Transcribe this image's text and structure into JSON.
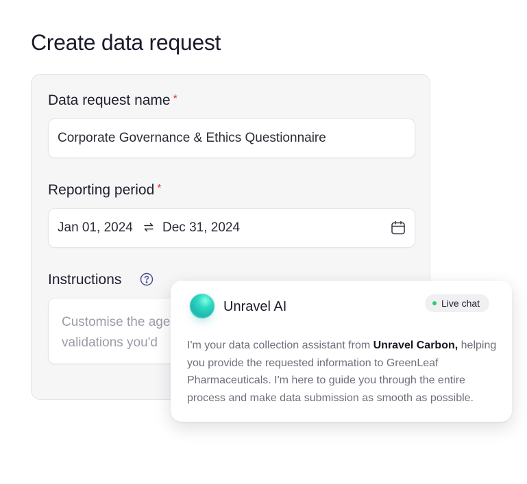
{
  "page": {
    "title": "Create data request"
  },
  "form": {
    "name_label": "Data request name",
    "name_value": "Corporate Governance & Ethics Questionnaire",
    "period_label": "Reporting period",
    "start_date": "Jan 01, 2024",
    "end_date": "Dec 31, 2024",
    "instructions_label": "Instructions",
    "instructions_placeholder_line1": "Customise the age",
    "instructions_placeholder_line2": "validations you'd",
    "required_mark": "*"
  },
  "chat": {
    "agent_name": "Unravel AI",
    "badge": "Live chat",
    "message_part1": "I'm your data collection assistant from ",
    "message_brand": "Unravel Carbon,",
    "message_part2": " helping you provide the requested information to GreenLeaf Pharmaceuticals. I'm here to guide you through the entire process and make data submission as smooth as possible."
  },
  "colors": {
    "required": "#e03131",
    "live_dot": "#2ecc71",
    "orb": "#2fd9c3"
  },
  "icons": [
    "swap-arrows-icon",
    "calendar-icon",
    "help-circle-icon"
  ]
}
